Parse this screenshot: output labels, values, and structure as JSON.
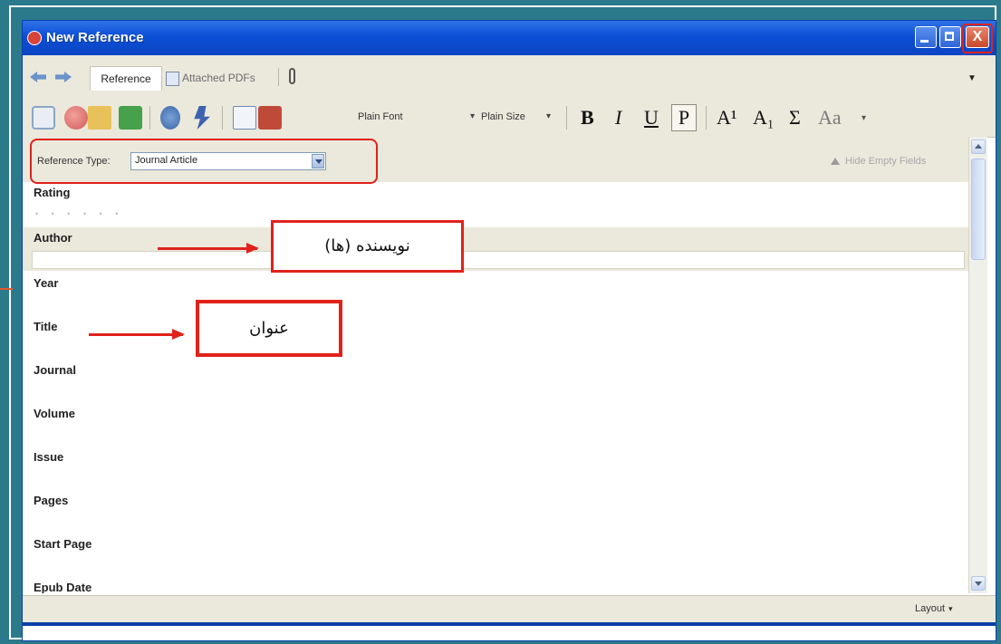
{
  "window": {
    "title": "New Reference",
    "close_label": "X"
  },
  "tabs": {
    "reference": "Reference",
    "attached_pdfs": "Attached PDFs"
  },
  "toolbar": {
    "font": "Plain Font",
    "size": "Plain Size",
    "bold": "B",
    "italic": "I",
    "underline": "U",
    "plain": "P",
    "superscript": "A¹",
    "subscript": "A₁",
    "symbol": "Σ",
    "case": "Aa",
    "dropdown_glyph": "▾"
  },
  "reference_type": {
    "label": "Reference Type:",
    "value": "Journal Article"
  },
  "hide_empty_fields": "Hide Empty Fields",
  "fields": {
    "rating": "Rating",
    "rating_stars": "• • • • • •",
    "author": "Author",
    "year": "Year",
    "title": "Title",
    "journal": "Journal",
    "volume": "Volume",
    "issue": "Issue",
    "pages": "Pages",
    "start_page": "Start Page",
    "epub_date": "Epub Date"
  },
  "status": {
    "layout": "Layout"
  },
  "annotations": {
    "author": "نویسنده (ها)",
    "title": "عنوان"
  },
  "colors": {
    "highlight": "#e0221b",
    "titlebar": "#0d4fd6",
    "chrome": "#ebe8dc",
    "background": "#2b7a8c"
  }
}
